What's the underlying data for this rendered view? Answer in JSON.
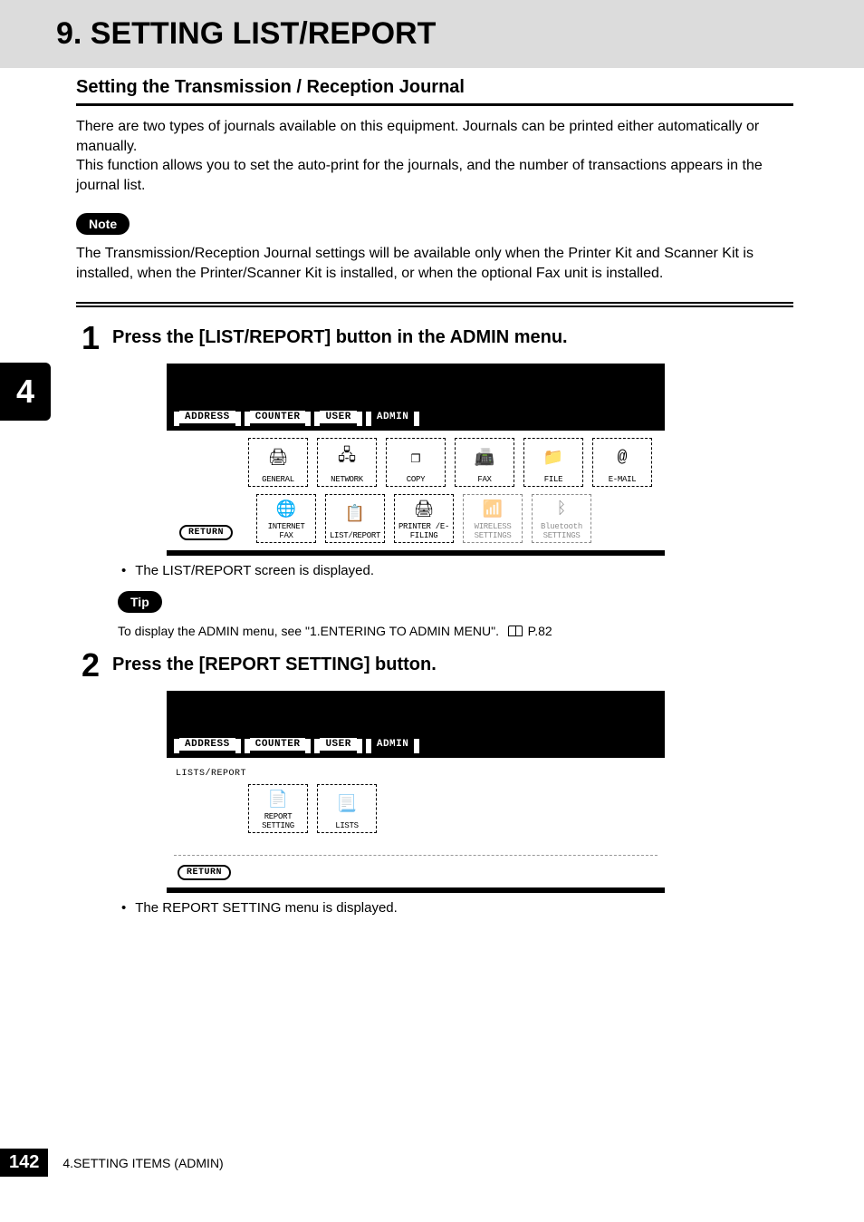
{
  "header": {
    "title": "9. SETTING LIST/REPORT"
  },
  "chapter_tab": "4",
  "section": {
    "heading": "Setting the Transmission / Reception Journal"
  },
  "paragraphs": {
    "intro": "There are two types of journals available on this equipment.  Journals can be printed either automatically or manually.\nThis function allows you to set the auto-print for the journals, and the number of transactions appears in the journal list."
  },
  "note": {
    "label": "Note",
    "text": "The Transmission/Reception Journal settings will be available only when the Printer Kit and Scanner Kit is installed, when the Printer/Scanner Kit is installed, or when the optional Fax unit is installed."
  },
  "steps": [
    {
      "num": "1",
      "title": "Press the [LIST/REPORT] button in the ADMIN menu.",
      "bullet": "The LIST/REPORT screen is displayed."
    },
    {
      "num": "2",
      "title": "Press the [REPORT SETTING] button.",
      "bullet": "The REPORT SETTING menu is displayed."
    }
  ],
  "tip": {
    "label": "Tip",
    "text_before": "To display the ADMIN menu, see \"1.ENTERING TO ADMIN MENU\".",
    "page_ref": "P.82"
  },
  "panel1": {
    "tabs": [
      "ADDRESS",
      "COUNTER",
      "USER",
      "ADMIN"
    ],
    "active_tab": "ADMIN",
    "row1": [
      {
        "label": "GENERAL",
        "glyph": "🖨"
      },
      {
        "label": "NETWORK",
        "glyph": "🖧"
      },
      {
        "label": "COPY",
        "glyph": "❐"
      },
      {
        "label": "FAX",
        "glyph": "📠"
      },
      {
        "label": "FILE",
        "glyph": "📁"
      },
      {
        "label": "E-MAIL",
        "glyph": "@"
      }
    ],
    "row2": [
      {
        "label": "INTERNET FAX",
        "glyph": "🌐",
        "disabled": false
      },
      {
        "label": "LIST/REPORT",
        "glyph": "📋",
        "disabled": false
      },
      {
        "label": "PRINTER /E-FILING",
        "glyph": "🖨",
        "disabled": false
      },
      {
        "label": "WIRELESS SETTINGS",
        "glyph": "📶",
        "disabled": true
      },
      {
        "label": "Bluetooth SETTINGS",
        "glyph": "ᛒ",
        "disabled": true
      }
    ],
    "return": "RETURN"
  },
  "panel2": {
    "tabs": [
      "ADDRESS",
      "COUNTER",
      "USER",
      "ADMIN"
    ],
    "active_tab": "ADMIN",
    "subtitle": "LISTS/REPORT",
    "buttons": [
      {
        "label": "REPORT SETTING",
        "glyph": "📄"
      },
      {
        "label": "LISTS",
        "glyph": "📃"
      }
    ],
    "return": "RETURN"
  },
  "footer": {
    "page_num": "142",
    "section": "4.SETTING ITEMS (ADMIN)"
  }
}
